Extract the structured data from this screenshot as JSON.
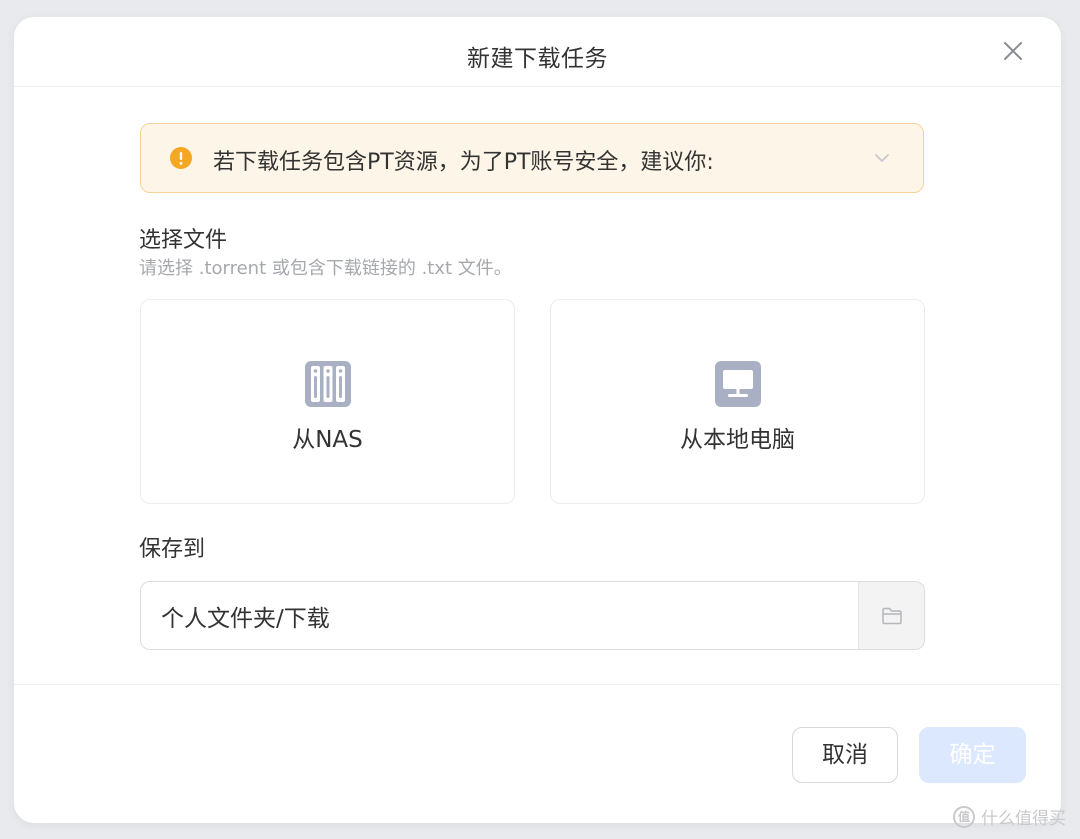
{
  "dialog": {
    "title": "新建下载任务"
  },
  "alert": {
    "text": "若下载任务包含PT资源，为了PT账号安全，建议你:",
    "icon": "warning-icon",
    "accent": "#f5a623"
  },
  "select_file": {
    "label": "选择文件",
    "hint": "请选择 .torrent 或包含下载链接的 .txt 文件。",
    "options": [
      {
        "label": "从NAS",
        "icon": "nas-icon"
      },
      {
        "label": "从本地电脑",
        "icon": "computer-icon"
      }
    ]
  },
  "save_to": {
    "label": "保存到",
    "path": "个人文件夹/下载",
    "folder_icon": "folder-icon"
  },
  "footer": {
    "cancel_label": "取消",
    "ok_label": "确定",
    "ok_color": "#dbe8fd"
  },
  "watermark": {
    "badge": "值",
    "text": "什么值得买"
  }
}
